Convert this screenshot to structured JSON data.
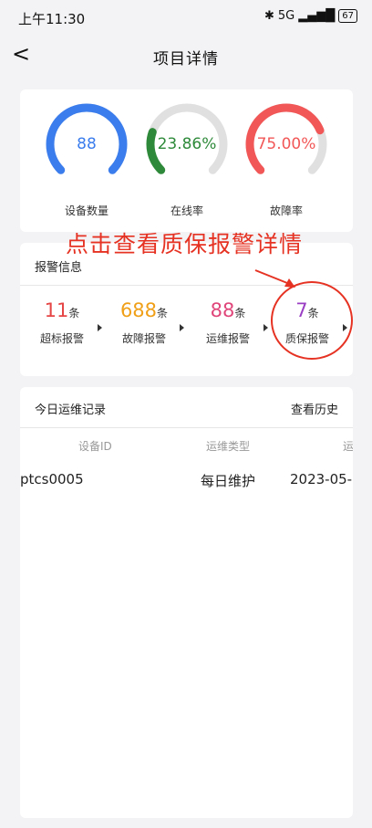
{
  "status_bar": {
    "time": "上午11:30",
    "network": "5G",
    "battery": "67"
  },
  "nav": {
    "back_label": "<",
    "title": "项目详情"
  },
  "gauges": [
    {
      "label": "设备数量",
      "value_text": "88",
      "fraction": 1.0,
      "color": "#3b7ded"
    },
    {
      "label": "在线率",
      "value_text": "23.86%",
      "fraction": 0.2386,
      "color": "#2e8a3a"
    },
    {
      "label": "故障率",
      "value_text": "75.00%",
      "fraction": 0.75,
      "color": "#f25757"
    }
  ],
  "annotation_text": "点击查看质保报警详情",
  "alarm": {
    "header": "报警信息",
    "items": [
      {
        "count": "11",
        "unit": "条",
        "label": "超标报警",
        "color": "#e64545"
      },
      {
        "count": "688",
        "unit": "条",
        "label": "故障报警",
        "color": "#f0a018"
      },
      {
        "count": "88",
        "unit": "条",
        "label": "运维报警",
        "color": "#e0457a"
      },
      {
        "count": "7",
        "unit": "条",
        "label": "质保报警",
        "color": "#9a3fc4"
      }
    ]
  },
  "records": {
    "title": "今日运维记录",
    "history_link": "查看历史",
    "columns": [
      "设备ID",
      "运维类型",
      "运"
    ],
    "rows": [
      [
        "ptcs0005",
        "每日维护",
        "2023-05-"
      ]
    ]
  }
}
